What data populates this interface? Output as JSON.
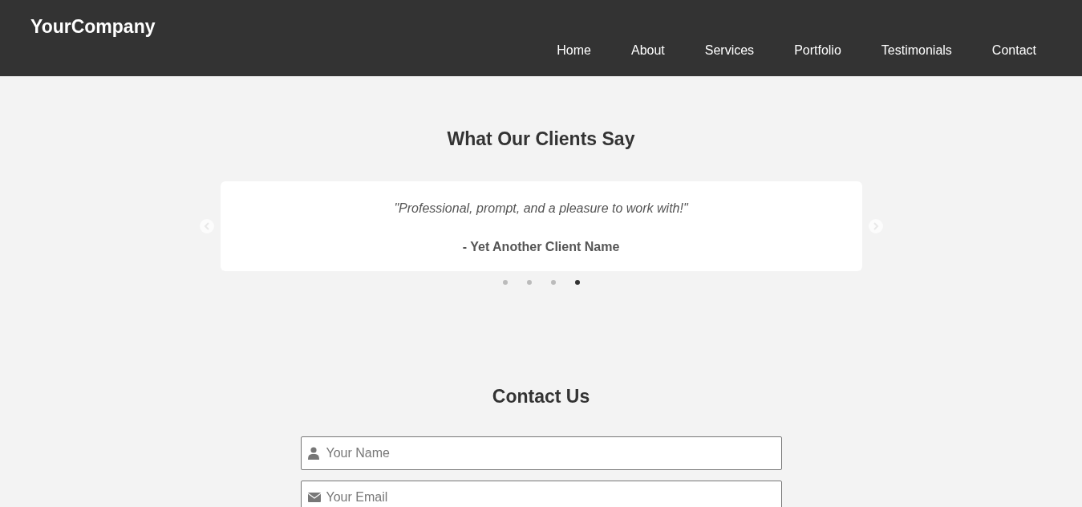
{
  "header": {
    "logo": "YourCompany",
    "nav": [
      {
        "label": "Home"
      },
      {
        "label": "About"
      },
      {
        "label": "Services"
      },
      {
        "label": "Portfolio"
      },
      {
        "label": "Testimonials"
      },
      {
        "label": "Contact"
      }
    ]
  },
  "testimonials": {
    "title": "What Our Clients Say",
    "quote": "\"Professional, prompt, and a pleasure to work with!\"",
    "author": "- Yet Another Client Name",
    "dots": [
      {
        "selected": false
      },
      {
        "selected": false
      },
      {
        "selected": false
      },
      {
        "selected": true
      }
    ]
  },
  "contact": {
    "title": "Contact Us",
    "fields": [
      {
        "kind": "name",
        "placeholder": "Your Name"
      },
      {
        "kind": "email",
        "placeholder": "Your Email"
      }
    ]
  }
}
